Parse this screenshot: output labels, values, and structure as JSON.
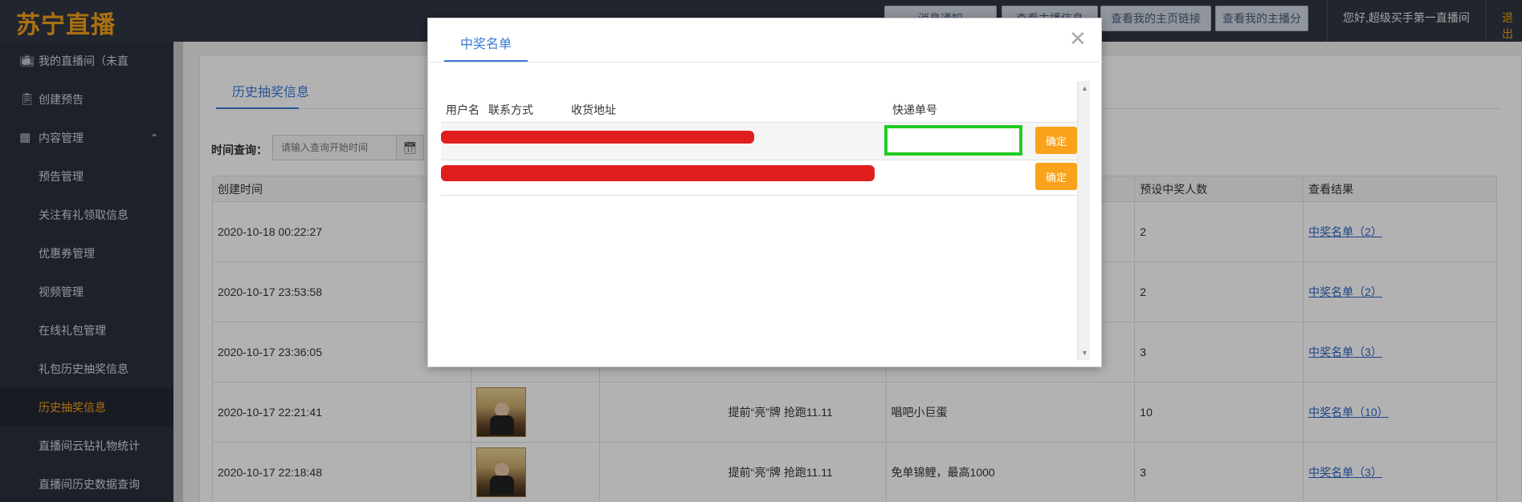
{
  "app": {
    "logo": "苏宁直播"
  },
  "topbar": {
    "buttons": [
      "消息通知",
      "查看主播信息",
      "查看我的主页链接",
      "查看我的主播分"
    ],
    "greeting": "您好,超级买手第一直播间",
    "exit": "退出"
  },
  "sidebar": {
    "items": [
      {
        "label": "我的直播间（未直",
        "icon": "tv-icon"
      },
      {
        "label": "创建预告",
        "icon": "clipboard-icon"
      },
      {
        "label": "内容管理",
        "icon": "grid-icon"
      },
      {
        "label": "预告管理"
      },
      {
        "label": "关注有礼领取信息"
      },
      {
        "label": "优惠券管理"
      },
      {
        "label": "视频管理"
      },
      {
        "label": "在线礼包管理"
      },
      {
        "label": "礼包历史抽奖信息"
      },
      {
        "label": "历史抽奖信息",
        "active": true
      },
      {
        "label": "直播间云钻礼物统计"
      },
      {
        "label": "直播间历史数据查询"
      }
    ]
  },
  "main": {
    "tab": "历史抽奖信息",
    "query_label": "时间查询：",
    "query_placeholder": "请输入查询开始时间",
    "table": {
      "headers": [
        "创建时间",
        "",
        "",
        "",
        "预设中奖人数",
        "查看结果"
      ],
      "rows": [
        {
          "time": "2020-10-18 00:22:27",
          "name": "",
          "prize": "",
          "num": "2",
          "result": "中奖名单（2）"
        },
        {
          "time": "2020-10-17 23:53:58",
          "name": "",
          "prize": "",
          "num": "2",
          "result": "中奖名单（2）"
        },
        {
          "time": "2020-10-17 23:36:05",
          "name": "",
          "prize": "",
          "num": "3",
          "result": "中奖名单（3）"
        },
        {
          "time": "2020-10-17 22:21:41",
          "name": "提前“亮”牌 抢跑11.11",
          "prize": "唱吧小巨蛋",
          "num": "10",
          "result": "中奖名单（10）"
        },
        {
          "time": "2020-10-17 22:18:48",
          "name": "提前“亮”牌 抢跑11.11",
          "prize": "免单锦鲤，最高1000",
          "num": "3",
          "result": "中奖名单（3）"
        }
      ]
    }
  },
  "modal": {
    "tab": "中奖名单",
    "columns": [
      "用户名",
      "联系方式",
      "收货地址",
      "快递单号"
    ],
    "confirm_label": "确定"
  }
}
